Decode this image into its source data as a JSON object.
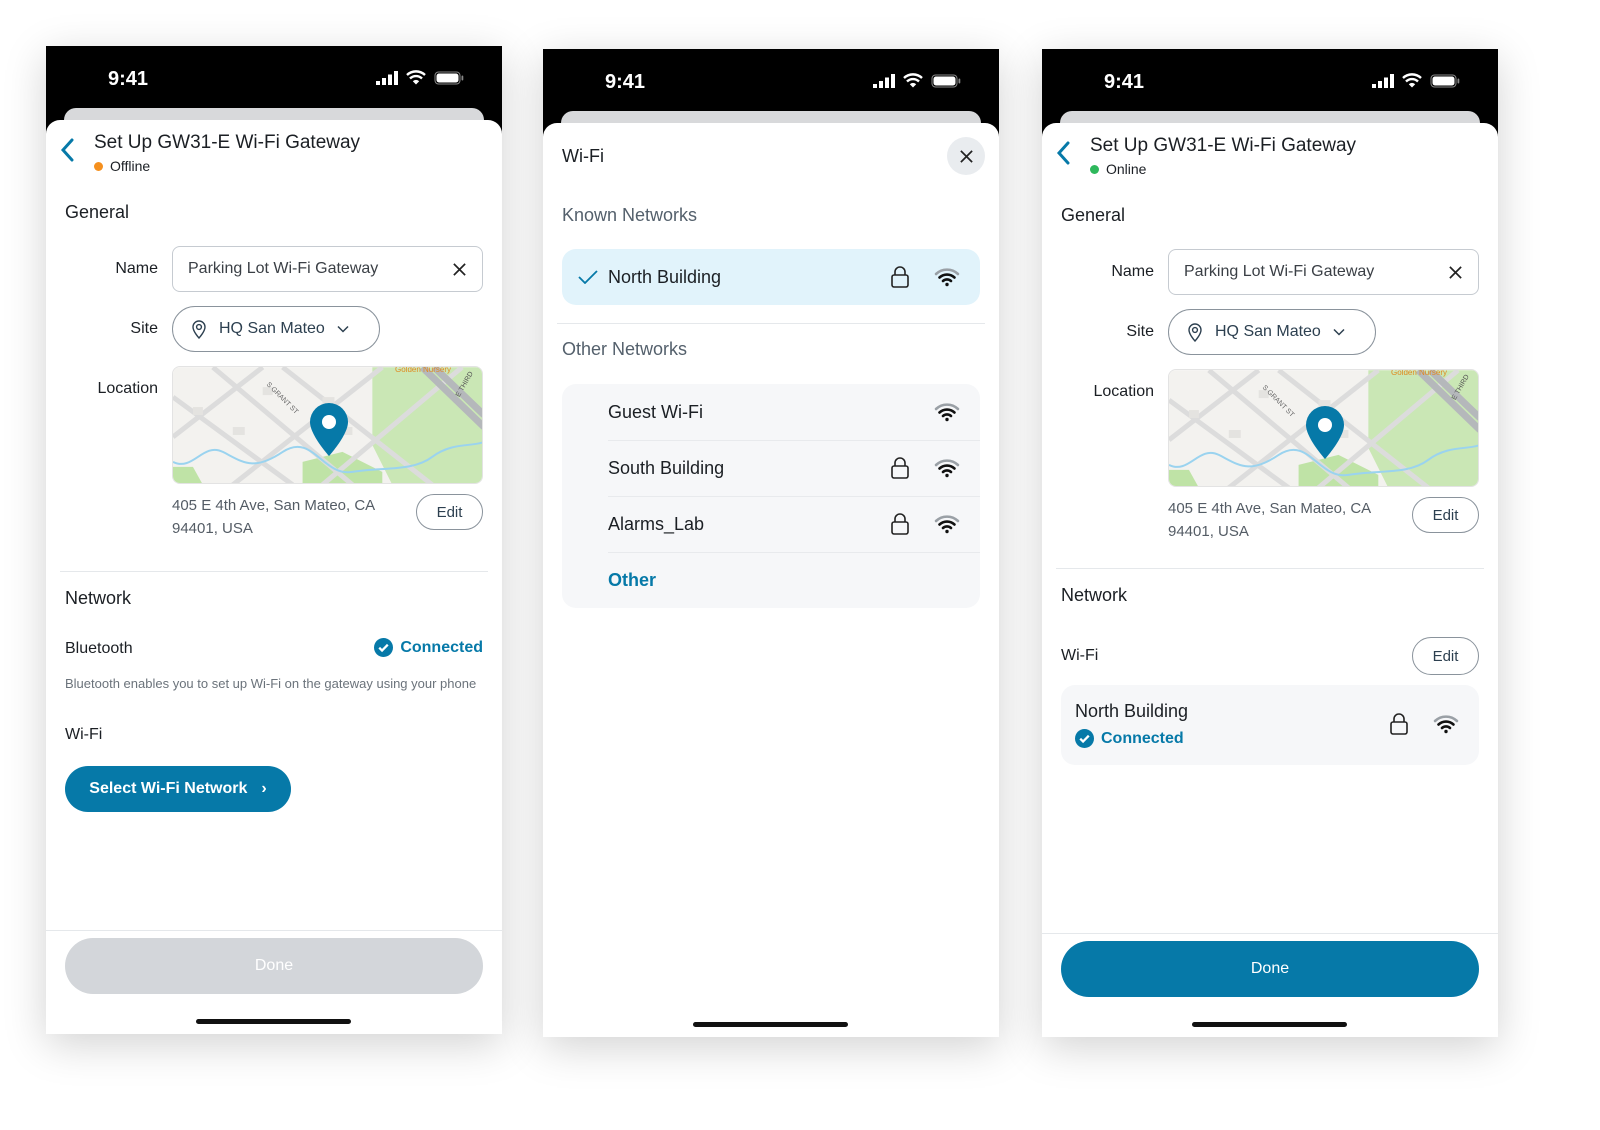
{
  "status_bar": {
    "time": "9:41"
  },
  "colors": {
    "accent": "#0679a8",
    "offline": "#f5901e",
    "online": "#2eb85c",
    "selected_row": "#e1f3fb"
  },
  "map": {
    "labels": [
      "S GRANT ST",
      "Golden Nursery",
      "E THIRD",
      "S H"
    ]
  },
  "screen1": {
    "title": "Set Up GW31-E Wi-Fi Gateway",
    "status": "Offline",
    "general": "General",
    "name_label": "Name",
    "name_value": "Parking Lot Wi-Fi Gateway",
    "site_label": "Site",
    "site_value": "HQ San Mateo",
    "location_label": "Location",
    "address": "405 E 4th Ave, San Mateo, CA 94401, USA",
    "edit": "Edit",
    "network": "Network",
    "bluetooth_label": "Bluetooth",
    "bluetooth_status": "Connected",
    "bluetooth_desc": "Bluetooth enables you to set up Wi-Fi on the gateway using your phone",
    "wifi_label": "Wi-Fi",
    "select_wifi": "Select Wi-Fi Network",
    "done": "Done"
  },
  "screen2": {
    "title": "Wi-Fi",
    "known_header": "Known Networks",
    "known": [
      {
        "name": "North Building",
        "secured": true,
        "selected": true
      }
    ],
    "other_header": "Other Networks",
    "other": [
      {
        "name": "Guest Wi-Fi",
        "secured": false
      },
      {
        "name": "South Building",
        "secured": true
      },
      {
        "name": "Alarms_Lab",
        "secured": true
      }
    ],
    "other_option": "Other"
  },
  "screen3": {
    "title": "Set Up GW31-E Wi-Fi Gateway",
    "status": "Online",
    "general": "General",
    "name_label": "Name",
    "name_value": "Parking Lot Wi-Fi Gateway",
    "site_label": "Site",
    "site_value": "HQ San Mateo",
    "location_label": "Location",
    "address": "405 E 4th Ave, San Mateo, CA 94401, USA",
    "edit": "Edit",
    "network": "Network",
    "wifi_label": "Wi-Fi",
    "wifi_edit": "Edit",
    "wifi_network": "North Building",
    "wifi_status": "Connected",
    "done": "Done"
  }
}
